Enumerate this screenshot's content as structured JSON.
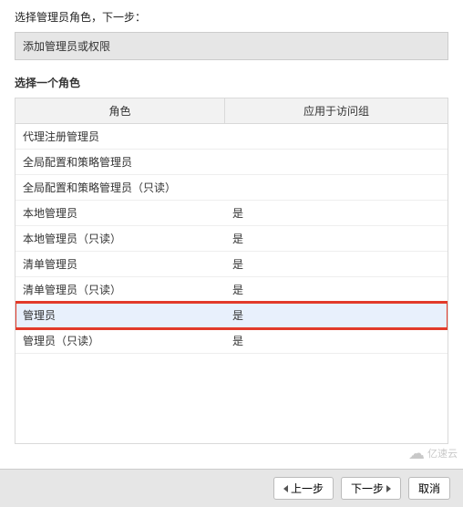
{
  "header": {
    "title": "选择管理员角色，下一步：",
    "step_label": "添加管理员或权限"
  },
  "section": {
    "select_role_label": "选择一个角色"
  },
  "table": {
    "columns": {
      "role": "角色",
      "apply_to_group": "应用于访问组"
    },
    "rows": [
      {
        "role": "代理注册管理员",
        "apply": ""
      },
      {
        "role": "全局配置和策略管理员",
        "apply": ""
      },
      {
        "role": "全局配置和策略管理员（只读）",
        "apply": ""
      },
      {
        "role": "本地管理员",
        "apply": "是"
      },
      {
        "role": "本地管理员（只读）",
        "apply": "是"
      },
      {
        "role": "清单管理员",
        "apply": "是"
      },
      {
        "role": "清单管理员（只读）",
        "apply": "是"
      },
      {
        "role": "管理员",
        "apply": "是",
        "selected": true
      },
      {
        "role": "管理员（只读）",
        "apply": "是"
      }
    ]
  },
  "buttons": {
    "prev": "上一步",
    "next": "下一步",
    "cancel": "取消"
  },
  "watermark": "亿速云"
}
